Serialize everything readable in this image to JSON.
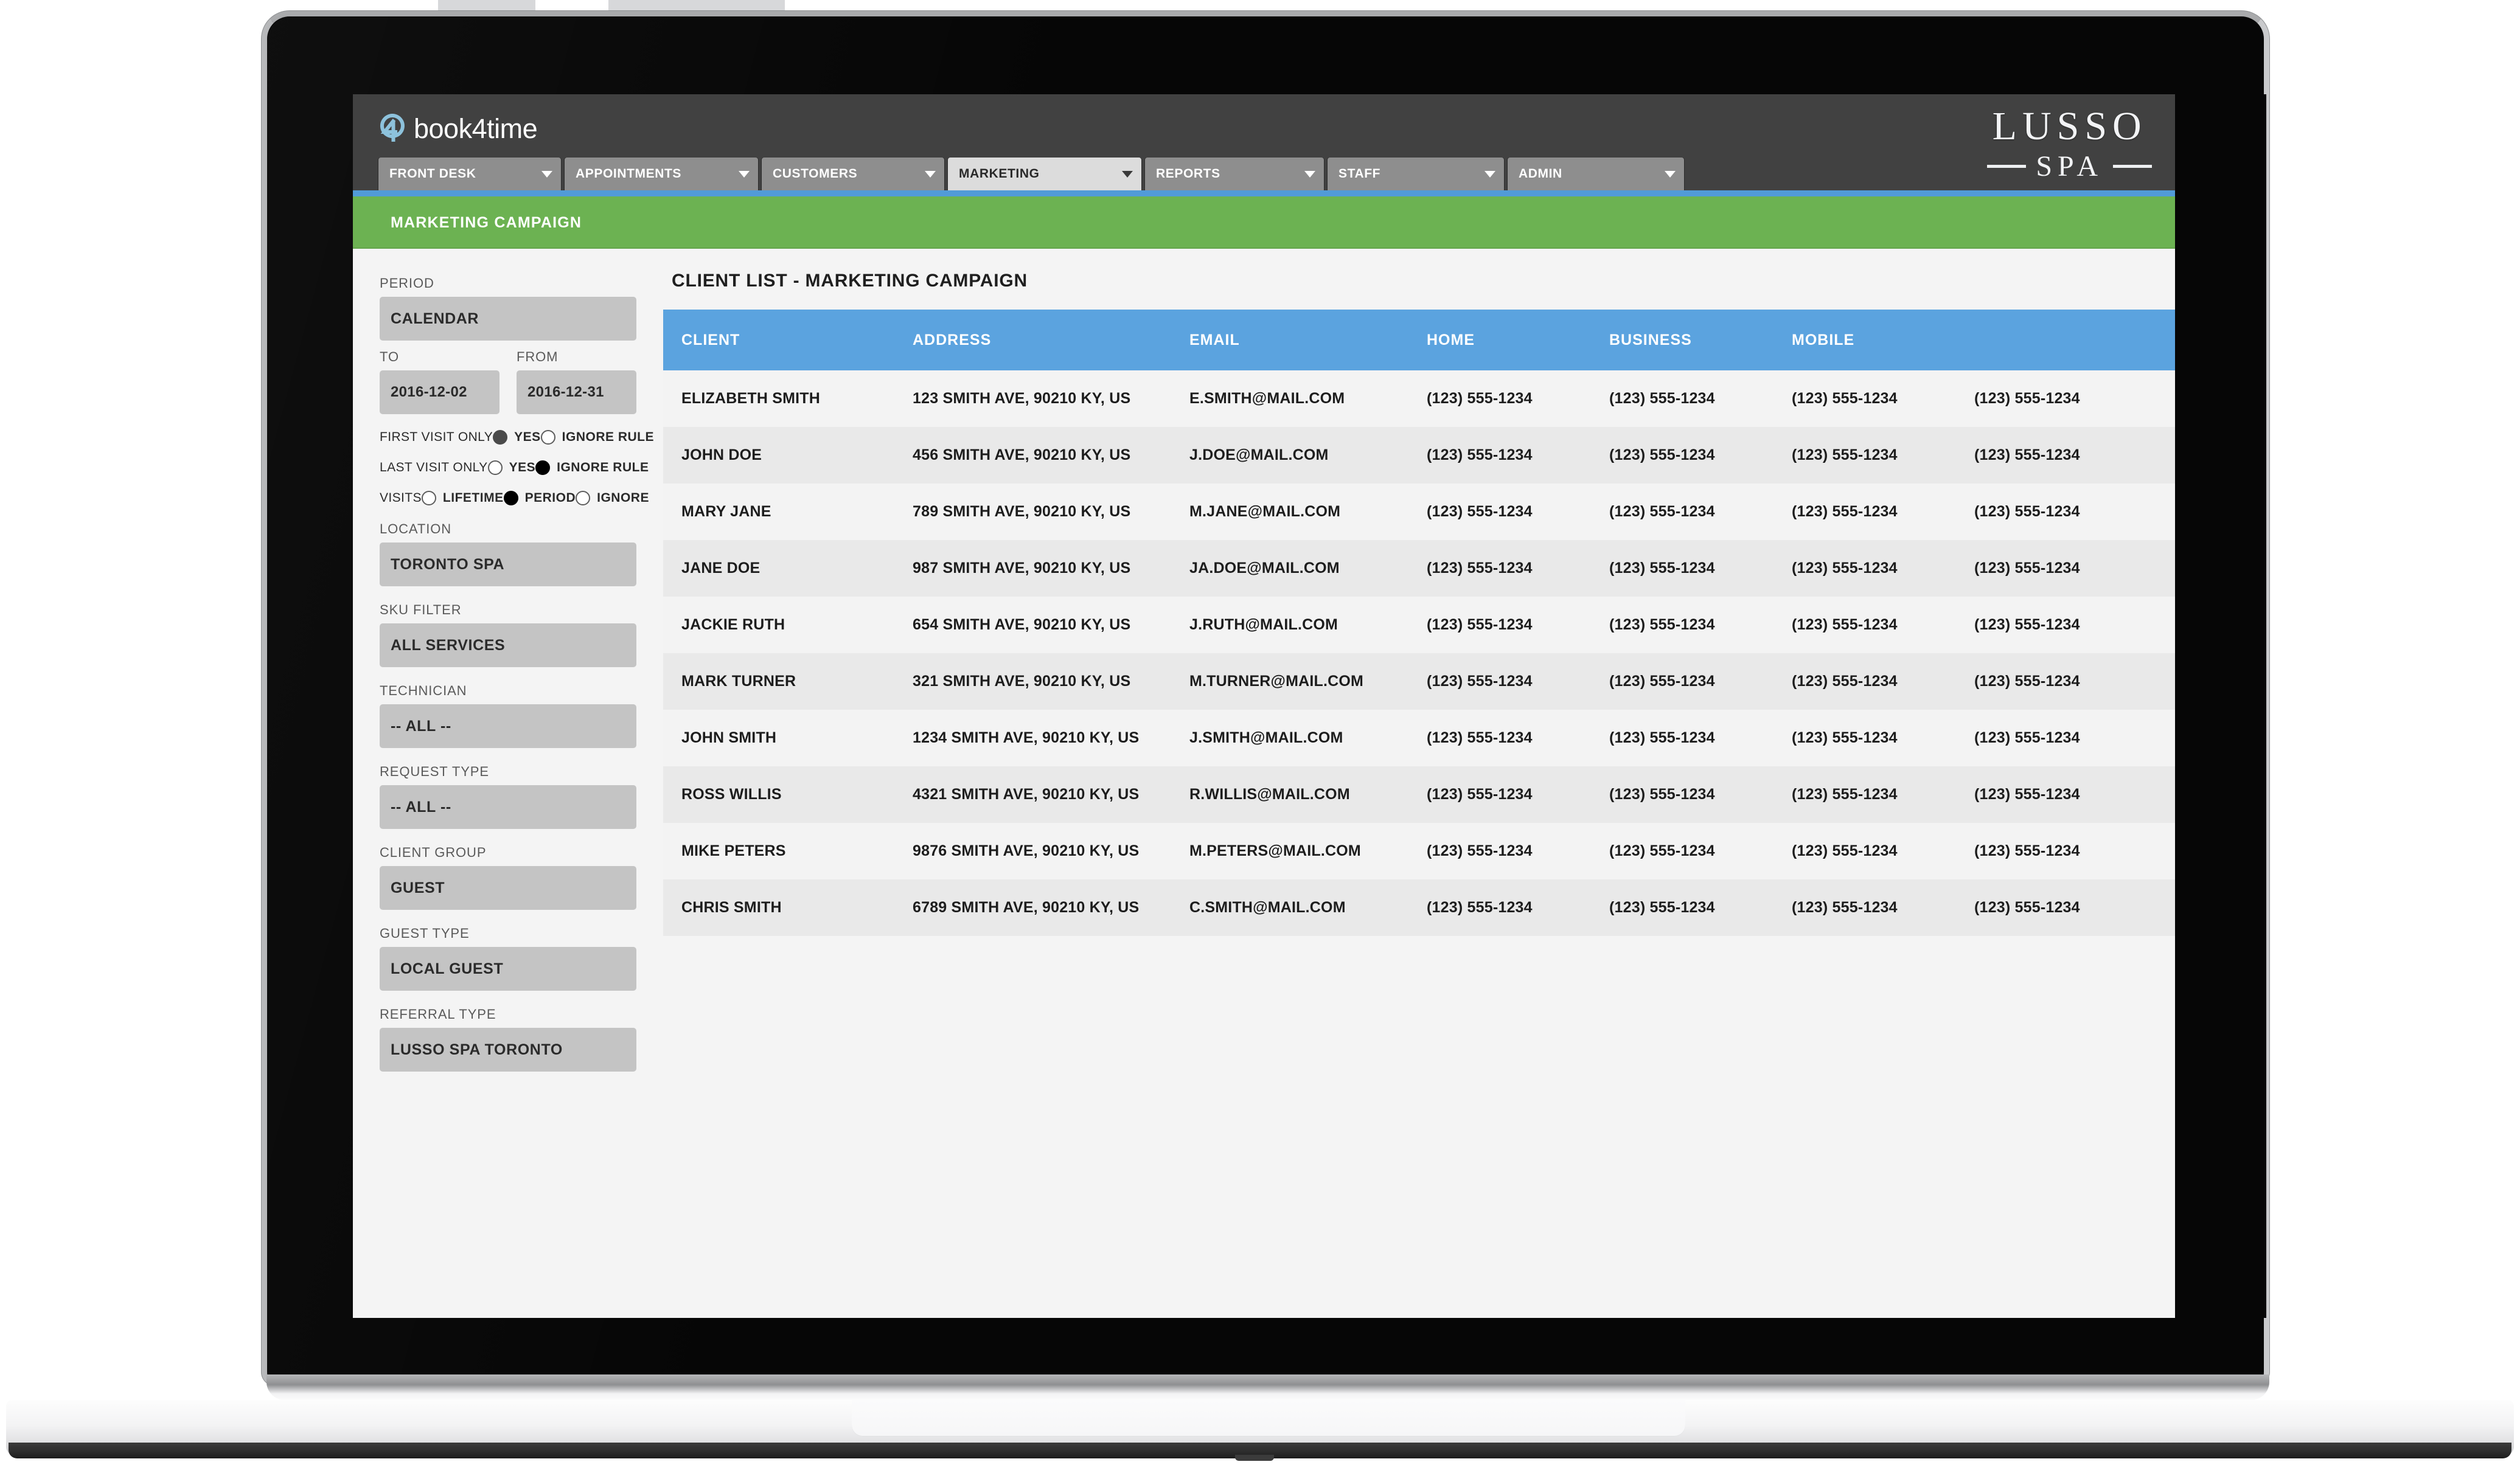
{
  "app": {
    "brand_name": "book4time",
    "brand_icon": "book4time-circle-4-logo",
    "property_logo_line1": "LUSSO",
    "property_logo_line2": "SPA"
  },
  "nav": {
    "items": [
      {
        "label": "FRONT DESK",
        "active": false
      },
      {
        "label": "APPOINTMENTS",
        "active": false
      },
      {
        "label": "CUSTOMERS",
        "active": false
      },
      {
        "label": "MARKETING",
        "active": true
      },
      {
        "label": "REPORTS",
        "active": false
      },
      {
        "label": "STAFF",
        "active": false
      },
      {
        "label": "ADMIN",
        "active": false
      }
    ]
  },
  "module_bar": {
    "title": "MARKETING CAMPAIGN"
  },
  "sidebar": {
    "period": {
      "label": "PERIOD",
      "calendar_value": "CALENDAR",
      "to_label": "TO",
      "to_value": "2016-12-02",
      "from_label": "FROM",
      "from_value": "2016-12-31"
    },
    "first_visit_only": {
      "label": "FIRST VISIT ONLY",
      "yes_label": "YES",
      "ignore_label": "IGNORE RULE",
      "selected": "YES"
    },
    "last_visit_only": {
      "label": "LAST VISIT ONLY",
      "yes_label": "YES",
      "ignore_label": "IGNORE RULE",
      "selected": "IGNORE RULE"
    },
    "visits": {
      "label": "VISITS",
      "lifetime_label": "LIFETIME",
      "period_label": "PERIOD",
      "ignore_label": "IGNORE",
      "selected": "PERIOD"
    },
    "location": {
      "label": "LOCATION",
      "value": "TORONTO SPA"
    },
    "sku_filter": {
      "label": "SKU FILTER",
      "value": "ALL SERVICES"
    },
    "technician": {
      "label": "TECHNICIAN",
      "value": "-- ALL --"
    },
    "request_type": {
      "label": "REQUEST TYPE",
      "value": "-- ALL --"
    },
    "client_group": {
      "label": "CLIENT GROUP",
      "value": "GUEST"
    },
    "guest_type": {
      "label": "GUEST TYPE",
      "value": "LOCAL GUEST"
    },
    "referral_type": {
      "label": "REFERRAL TYPE",
      "value": "LUSSO SPA TORONTO"
    }
  },
  "main": {
    "title": "CLIENT LIST - MARKETING CAMPAIGN",
    "table": {
      "columns": [
        "CLIENT",
        "ADDRESS",
        "EMAIL",
        "HOME",
        "BUSINESS",
        "MOBILE",
        ""
      ],
      "rows": [
        {
          "client": "ELIZABETH SMITH",
          "address": "123 SMITH AVE, 90210 KY, US",
          "email": "E.SMITH@MAIL.COM",
          "home": "(123) 555-1234",
          "business": "(123) 555-1234",
          "mobile": "(123) 555-1234",
          "extra": "(123) 555-1234"
        },
        {
          "client": "JOHN DOE",
          "address": "456 SMITH AVE, 90210 KY, US",
          "email": "J.DOE@MAIL.COM",
          "home": "(123) 555-1234",
          "business": "(123) 555-1234",
          "mobile": "(123) 555-1234",
          "extra": "(123) 555-1234"
        },
        {
          "client": "MARY JANE",
          "address": "789 SMITH AVE, 90210 KY, US",
          "email": "M.JANE@MAIL.COM",
          "home": "(123) 555-1234",
          "business": "(123) 555-1234",
          "mobile": "(123) 555-1234",
          "extra": "(123) 555-1234"
        },
        {
          "client": "JANE DOE",
          "address": "987 SMITH AVE, 90210 KY, US",
          "email": "JA.DOE@MAIL.COM",
          "home": "(123) 555-1234",
          "business": "(123) 555-1234",
          "mobile": "(123) 555-1234",
          "extra": "(123) 555-1234"
        },
        {
          "client": "JACKIE RUTH",
          "address": "654 SMITH AVE, 90210 KY, US",
          "email": "J.RUTH@MAIL.COM",
          "home": "(123) 555-1234",
          "business": "(123) 555-1234",
          "mobile": "(123) 555-1234",
          "extra": "(123) 555-1234"
        },
        {
          "client": "MARK TURNER",
          "address": "321 SMITH AVE, 90210 KY, US",
          "email": "M.TURNER@MAIL.COM",
          "home": "(123) 555-1234",
          "business": "(123) 555-1234",
          "mobile": "(123) 555-1234",
          "extra": "(123) 555-1234"
        },
        {
          "client": "JOHN SMITH",
          "address": "1234 SMITH AVE, 90210 KY, US",
          "email": "J.SMITH@MAIL.COM",
          "home": "(123) 555-1234",
          "business": "(123) 555-1234",
          "mobile": "(123) 555-1234",
          "extra": "(123) 555-1234"
        },
        {
          "client": "ROSS WILLIS",
          "address": "4321 SMITH AVE, 90210 KY, US",
          "email": "R.WILLIS@MAIL.COM",
          "home": "(123) 555-1234",
          "business": "(123) 555-1234",
          "mobile": "(123) 555-1234",
          "extra": "(123) 555-1234"
        },
        {
          "client": "MIKE PETERS",
          "address": "9876 SMITH AVE, 90210 KY, US",
          "email": "M.PETERS@MAIL.COM",
          "home": "(123) 555-1234",
          "business": "(123) 555-1234",
          "mobile": "(123) 555-1234",
          "extra": "(123) 555-1234"
        },
        {
          "client": "CHRIS SMITH",
          "address": "6789 SMITH AVE, 90210 KY, US",
          "email": "C.SMITH@MAIL.COM",
          "home": "(123) 555-1234",
          "business": "(123) 555-1234",
          "mobile": "(123) 555-1234",
          "extra": "(123) 555-1234"
        }
      ]
    }
  },
  "colors": {
    "topbar": "#414141",
    "nav_tab": "#8e8e8e",
    "nav_tab_active": "#dcdcdc",
    "accent_blue": "#519bd8",
    "table_header_blue": "#5ba3df",
    "module_green": "#6cb252",
    "field_grey": "#c4c4c4",
    "row_odd": "#f3f3f3",
    "row_even": "#e9e9e9",
    "brand_icon_blue": "#8dc2dc"
  }
}
